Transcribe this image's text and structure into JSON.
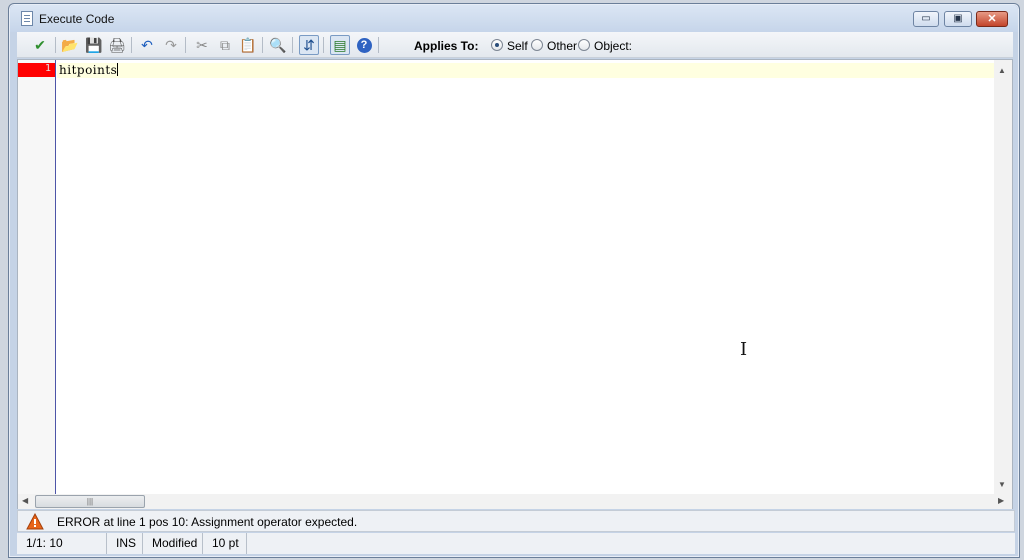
{
  "window": {
    "title": "Execute Code",
    "controls": {
      "minimize": "▭",
      "maximize": "▣",
      "close": "✕"
    }
  },
  "toolbar": {
    "buttons": [
      {
        "name": "accept-icon",
        "glyph": "✔",
        "color": "#2f8f2f"
      },
      {
        "name": "open-icon",
        "glyph": "📂",
        "color": "#d8a030"
      },
      {
        "name": "save-icon",
        "glyph": "💾",
        "color": "#2a4fa0"
      },
      {
        "name": "print-icon",
        "glyph": "🖨",
        "color": "#555"
      },
      {
        "name": "undo-icon",
        "glyph": "↶",
        "color": "#1f5fbf"
      },
      {
        "name": "redo-icon",
        "glyph": "↷",
        "color": "#999"
      },
      {
        "name": "cut-icon",
        "glyph": "✂",
        "color": "#888"
      },
      {
        "name": "copy-icon",
        "glyph": "⧉",
        "color": "#888"
      },
      {
        "name": "paste-icon",
        "glyph": "📋",
        "color": "#888"
      },
      {
        "name": "find-icon",
        "glyph": "🔍",
        "color": "#555"
      },
      {
        "name": "code-completion-icon",
        "glyph": "⇵",
        "color": "#1f4f8f"
      },
      {
        "name": "insert-icon",
        "glyph": "▤",
        "color": "#2a7a2a"
      },
      {
        "name": "help-icon",
        "glyph": "?",
        "color": "#fff"
      }
    ],
    "applies_to_label": "Applies To:",
    "applies_options": [
      {
        "label": "Self",
        "selected": true
      },
      {
        "label": "Other",
        "selected": false
      },
      {
        "label": "Object:",
        "selected": false
      }
    ]
  },
  "editor": {
    "line_number": "1",
    "code": "hitpoints"
  },
  "error": {
    "message": "ERROR at line 1 pos 10: Assignment operator expected."
  },
  "status": {
    "position": "1/1: 10",
    "mode": "INS",
    "state": "Modified",
    "font_size": "10 pt"
  }
}
